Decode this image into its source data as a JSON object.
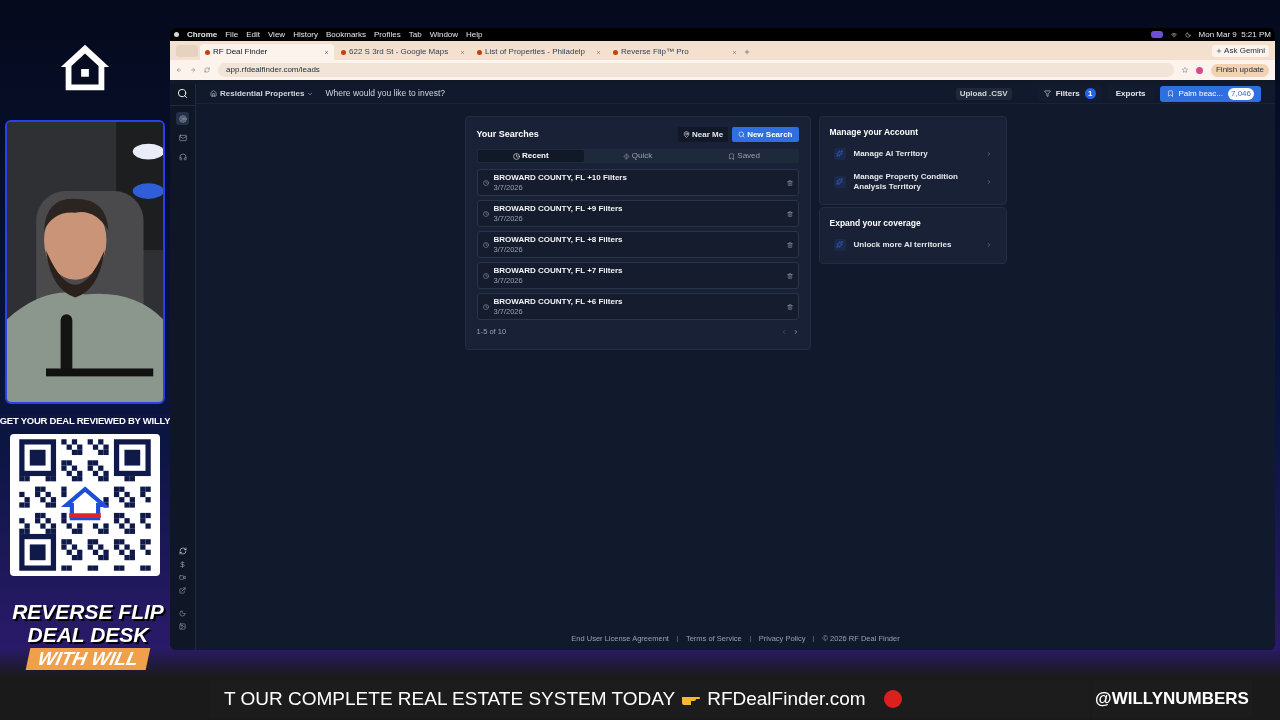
{
  "stream_overlay": {
    "qr_title": "GET YOUR DEAL REVIEWED BY WILLY",
    "brand_lines": [
      "REVERSE FLIP",
      "DEAL DESK",
      "WITH WILL"
    ],
    "ticker": {
      "text": "T OUR COMPLETE REAL ESTATE SYSTEM TODAY",
      "link": "RFDealFinder.com"
    },
    "handle": "@WILLYNUMBERS"
  },
  "menubar": {
    "app": "Chrome",
    "items": [
      "File",
      "Edit",
      "View",
      "History",
      "Bookmarks",
      "Profiles",
      "Tab",
      "Window",
      "Help"
    ],
    "clock": "Mon Mar 9  5:21 PM"
  },
  "browser_tabs": [
    {
      "title": "RF Deal Finder",
      "selected": true
    },
    {
      "title": "622 S 3rd St - Google Maps",
      "selected": false
    },
    {
      "title": "List of Properties - Philadelp",
      "selected": false
    },
    {
      "title": "Reverse Flip™ Pro",
      "selected": false
    }
  ],
  "ask_button": "Ask Gemini",
  "address_bar": {
    "url": "app.rfdealfinder.com/leads",
    "update_button": "Finish update"
  },
  "nav_icons": [
    {
      "selected": true
    },
    {
      "selected": false
    },
    {
      "selected": false
    }
  ],
  "header": {
    "property_type": "Residential Properties",
    "search_placeholder": "Where would you like to invest?",
    "upload": "Upload .CSV",
    "filters": {
      "label": "Filters",
      "count": "1"
    },
    "exports": "Exports",
    "territory": {
      "label": "Palm beac...",
      "count": "7,046"
    }
  },
  "searches": {
    "title": "Your Searches",
    "near_me": "Near Me",
    "new_search": "New Search",
    "tabs": [
      {
        "label": "Recent",
        "kind": "recent",
        "selected": true
      },
      {
        "label": "Quick",
        "kind": "quick",
        "selected": false
      },
      {
        "label": "Saved",
        "kind": "saved",
        "selected": false
      }
    ],
    "rows": [
      {
        "title": "BROWARD COUNTY, FL +10 Filters",
        "date": "3/7/2026"
      },
      {
        "title": "BROWARD COUNTY, FL +9 Filters",
        "date": "3/7/2026"
      },
      {
        "title": "BROWARD COUNTY, FL +8 Filters",
        "date": "3/7/2026"
      },
      {
        "title": "BROWARD COUNTY, FL +7 Filters",
        "date": "3/7/2026"
      },
      {
        "title": "BROWARD COUNTY, FL +6 Filters",
        "date": "3/7/2026"
      }
    ],
    "pagination": "1-5 of 10"
  },
  "account": {
    "title": "Manage your Account",
    "items": [
      "Manage AI Territory",
      "Manage Property Condition Analysis Territory"
    ]
  },
  "coverage": {
    "title": "Expand your coverage",
    "items": [
      "Unlock more AI territories"
    ]
  },
  "footer": {
    "links": [
      "End User License Agreement",
      "Terms of Service",
      "Privacy Policy"
    ],
    "copyright": "© 2026 RF Deal Finder"
  }
}
